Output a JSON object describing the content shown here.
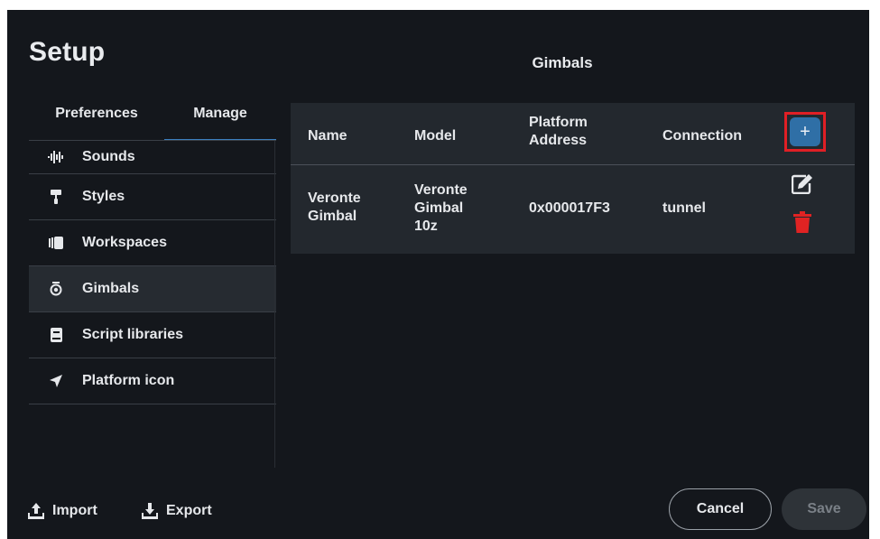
{
  "dialog": {
    "title": "Setup",
    "section_title": "Gimbals"
  },
  "tabs": [
    {
      "label": "Preferences",
      "active": false
    },
    {
      "label": "Manage",
      "active": true
    }
  ],
  "sidebar": {
    "items": [
      {
        "label": "Sounds",
        "icon": "sound-wave-icon",
        "active": false
      },
      {
        "label": "Styles",
        "icon": "paint-roller-icon",
        "active": false
      },
      {
        "label": "Workspaces",
        "icon": "workspaces-icon",
        "active": false
      },
      {
        "label": "Gimbals",
        "icon": "gimbal-camera-icon",
        "active": true
      },
      {
        "label": "Script libraries",
        "icon": "book-icon",
        "active": false
      },
      {
        "label": "Platform icon",
        "icon": "location-arrow-icon",
        "active": false
      }
    ]
  },
  "table": {
    "headers": {
      "name": "Name",
      "model": "Model",
      "platform_address": "Platform Address",
      "connection": "Connection"
    },
    "add_button_label": "+",
    "rows": [
      {
        "name": "Veronte Gimbal",
        "model": "Veronte Gimbal 10z",
        "platform_address": "0x000017F3",
        "connection": "tunnel"
      }
    ]
  },
  "footer": {
    "import_label": "Import",
    "export_label": "Export",
    "cancel_label": "Cancel",
    "save_label": "Save"
  },
  "colors": {
    "background": "#14171c",
    "panel": "#23282e",
    "accent": "#3b7fbf",
    "add_button": "#2f6fa6",
    "highlight_border": "#e01f25",
    "delete_icon": "#e02323"
  }
}
